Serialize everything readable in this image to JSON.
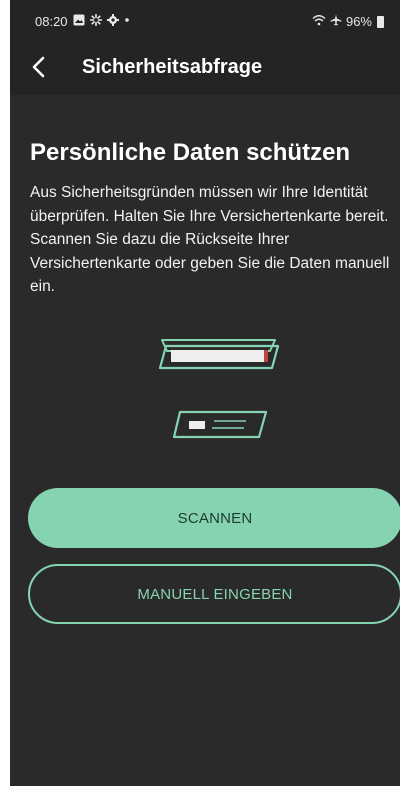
{
  "status_bar": {
    "time": "08:20",
    "icons_left": [
      "image-icon",
      "settings-icon",
      "gear-icon",
      "dot-icon"
    ],
    "icons_right": [
      "wifi-icon",
      "airplane-icon"
    ],
    "battery": "96%"
  },
  "app_bar": {
    "title": "Sicherheitsabfrage",
    "back_icon": "chevron-left-icon"
  },
  "main": {
    "heading": "Persönliche Daten schützen",
    "description": "Aus Sicherheitsgründen müssen wir Ihre Identität überprüfen. Halten Sie Ihre Versichertenkarte bereit. Scannen Sie dazu die Rückseite Ihrer Versichertenkarte oder geben Sie die Daten manuell ein."
  },
  "actions": {
    "scan_label": "SCANNEN",
    "manual_label": "MANUELL EINGEBEN"
  },
  "colors": {
    "background": "#2a2a2a",
    "topbar": "#242424",
    "accent": "#86d3b2",
    "accent_text_dark": "#1f3b31",
    "card_highlight": "#c0453f"
  }
}
